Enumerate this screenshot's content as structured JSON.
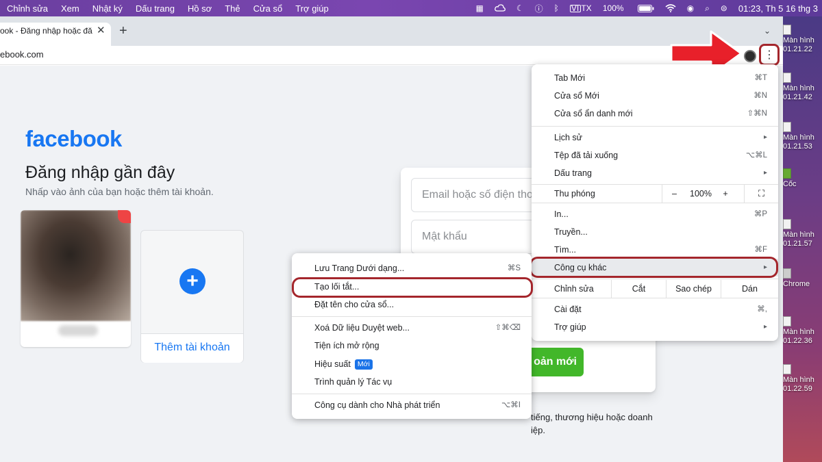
{
  "menubar": {
    "menus": [
      "Chỉnh sửa",
      "Xem",
      "Nhật ký",
      "Dấu trang",
      "Hồ sơ",
      "Thẻ",
      "Cửa sổ",
      "Trợ giúp"
    ],
    "battery": "100%",
    "input_source": "VI TX",
    "clock": "01:23, Th 5 16 thg 3"
  },
  "desktop": {
    "items": [
      {
        "line1": "Màn hình",
        "line2": "01.21.22"
      },
      {
        "line1": "Màn hình",
        "line2": "01.21.42"
      },
      {
        "line1": "Màn hình",
        "line2": "01.21.53"
      },
      {
        "line1": "Cốc",
        "line2": ""
      },
      {
        "line1": "Màn hình",
        "line2": "01.21.57"
      },
      {
        "line1": "Chrome",
        "line2": ""
      },
      {
        "line1": "Màn hình",
        "line2": "01.22.36"
      },
      {
        "line1": "Màn hình",
        "line2": "01.22.59"
      }
    ]
  },
  "browser": {
    "tab_title": "ook - Đăng nhập hoặc đă",
    "url": "ebook.com"
  },
  "facebook": {
    "logo": "facebook",
    "recent_title": "Đăng nhập gần đây",
    "recent_subtitle": "Nhấp vào ảnh của bạn hoặc thêm tài khoản.",
    "add_account": "Thêm tài khoản",
    "email_placeholder": "Email hoặc số điện thoại",
    "password_placeholder": "Mật khẩu",
    "create_account": "oản mới",
    "footer_line1": "tiếng, thương hiệu hoặc doanh",
    "footer_line2": "iệp."
  },
  "chrome_menu": {
    "group1": [
      {
        "label": "Tab Mới",
        "shortcut": "⌘T"
      },
      {
        "label": "Cửa sổ Mới",
        "shortcut": "⌘N"
      },
      {
        "label": "Cửa sổ ẩn danh mới",
        "shortcut": "⇧⌘N"
      }
    ],
    "group2": [
      {
        "label": "Lịch sử",
        "shortcut": ""
      },
      {
        "label": "Tệp đã tải xuống",
        "shortcut": "⌥⌘L"
      },
      {
        "label": "Dấu trang",
        "shortcut": ""
      }
    ],
    "zoom": {
      "label": "Thu phóng",
      "minus": "–",
      "value": "100%",
      "plus": "+"
    },
    "group3": [
      {
        "label": "In...",
        "shortcut": "⌘P"
      },
      {
        "label": "Truyền...",
        "shortcut": ""
      },
      {
        "label": "Tìm...",
        "shortcut": "⌘F"
      },
      {
        "label": "Công cụ khác",
        "shortcut": ""
      }
    ],
    "edit": {
      "label": "Chỉnh sửa",
      "cut": "Cắt",
      "copy": "Sao chép",
      "paste": "Dán"
    },
    "group4": [
      {
        "label": "Cài đặt",
        "shortcut": "⌘,"
      },
      {
        "label": "Trợ giúp",
        "shortcut": ""
      }
    ]
  },
  "submenu": {
    "group1": [
      {
        "label": "Lưu Trang Dưới dạng...",
        "shortcut": "⌘S"
      },
      {
        "label": "Tạo lối tắt...",
        "shortcut": ""
      },
      {
        "label": "Đặt tên cho cửa sổ...",
        "shortcut": ""
      }
    ],
    "group2": [
      {
        "label": "Xoá Dữ liệu Duyệt web...",
        "shortcut": "⇧⌘⌫"
      },
      {
        "label": "Tiện ích mở rộng",
        "shortcut": ""
      },
      {
        "label": "Hiệu suất",
        "shortcut": "",
        "badge": "Mới"
      },
      {
        "label": "Trình quản lý Tác vụ",
        "shortcut": ""
      }
    ],
    "group3": [
      {
        "label": "Công cụ dành cho Nhà phát triển",
        "shortcut": "⌥⌘I"
      }
    ]
  },
  "colors": {
    "fb_blue": "#1877f2",
    "highlight_red": "#a4262c",
    "arrow_red": "#e8202a",
    "fb_green": "#42b72a"
  }
}
